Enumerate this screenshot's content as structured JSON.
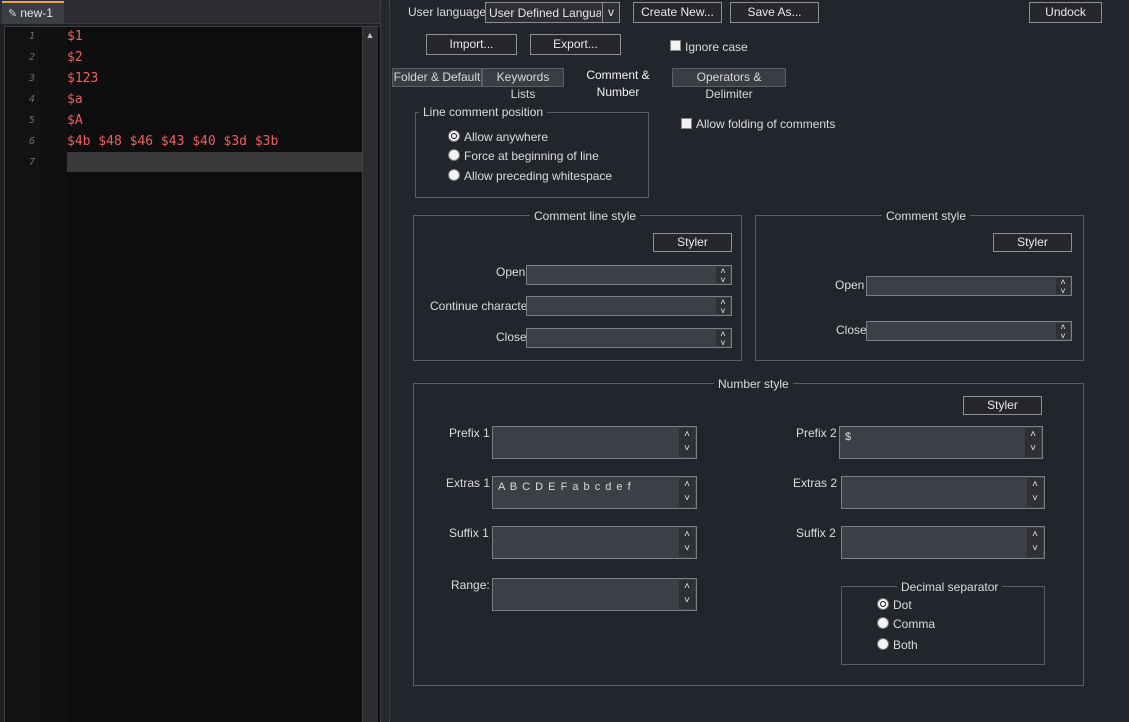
{
  "editor": {
    "tab_label": "new-1",
    "line_numbers": [
      "1",
      "2",
      "3",
      "4",
      "5",
      "6",
      "7"
    ],
    "lines": [
      "$1",
      "$2",
      "$123",
      "$a",
      "$A",
      "$4b $48 $46 $43 $40 $3d $3b",
      ""
    ]
  },
  "dialog": {
    "user_language_label": "User language:",
    "user_language_value": "User Defined Language",
    "user_language_dropdown": "v",
    "create_new": "Create New...",
    "save_as": "Save As...",
    "undock": "Undock",
    "import": "Import...",
    "export": "Export...",
    "ignore_case": "Ignore case",
    "tabs": [
      "Folder & Default",
      "Keywords Lists",
      "Comment & Number",
      "Operators & Delimiter"
    ],
    "active_tab": "Comment & Number",
    "line_comment_position": {
      "title": "Line comment position",
      "options": [
        "Allow anywhere",
        "Force at beginning of line",
        "Allow preceding whitespace"
      ],
      "selected": "Allow anywhere"
    },
    "allow_folding": "Allow folding of comments",
    "comment_line_style": {
      "title": "Comment line style",
      "styler": "Styler",
      "open": "Open",
      "continue": "Continue character",
      "close": "Close"
    },
    "comment_style": {
      "title": "Comment style",
      "styler": "Styler",
      "open": "Open",
      "close": "Close"
    },
    "number_style": {
      "title": "Number style",
      "styler": "Styler",
      "prefix1": "Prefix 1",
      "prefix1_value": "",
      "prefix2": "Prefix 2",
      "prefix2_value": "$",
      "extras1": "Extras 1",
      "extras1_value": "A B C D E F a b c d e f",
      "extras2": "Extras 2",
      "extras2_value": "",
      "suffix1": "Suffix 1",
      "suffix1_value": "",
      "suffix2": "Suffix 2",
      "suffix2_value": "",
      "range": "Range:",
      "range_value": ""
    },
    "decimal_separator": {
      "title": "Decimal separator",
      "options": [
        "Dot",
        "Comma",
        "Both"
      ],
      "selected": "Dot"
    },
    "spin_up": "˄",
    "spin_down": "˅"
  },
  "colors": {
    "code_text": "#f05f5f",
    "tab_accent": "#e8a33a",
    "background": "#22252b"
  },
  "icons": {
    "tab_icon": "pencil-icon"
  }
}
